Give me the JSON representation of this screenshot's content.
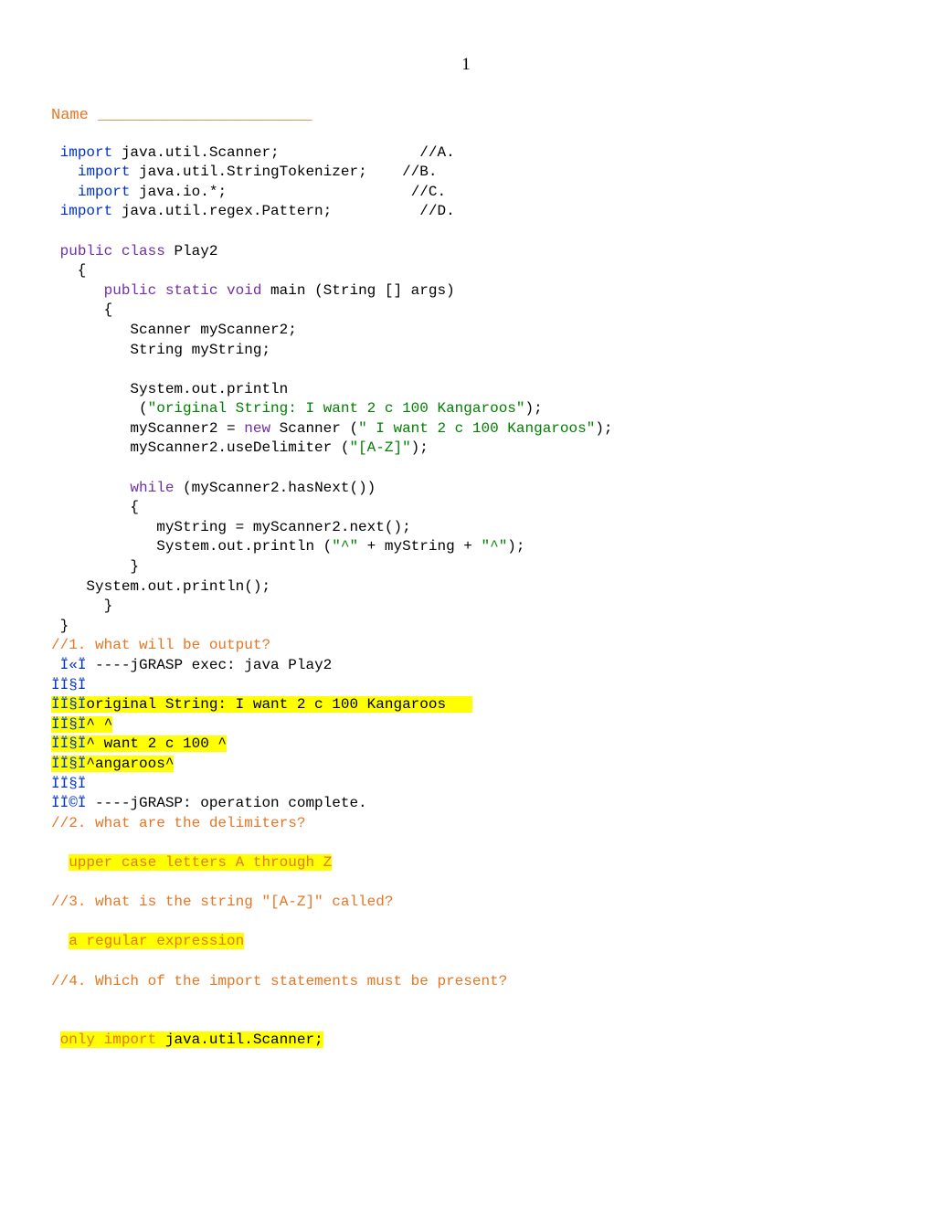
{
  "page_number": "1",
  "name_label": "Name _______________________",
  "code": {
    "kw_import": "import",
    "kw_public": "public",
    "kw_class": "class",
    "kw_static": "static",
    "kw_void": "void",
    "kw_new": "new",
    "kw_while": "while",
    "class_name": "Play2",
    "sig_main": " main (String [] args)",
    "import_a_pkg": " java.util.Scanner;",
    "import_a_cmt": "//A.",
    "import_b_pkg": " java.util.StringTokenizer;",
    "import_b_cmt": "//B.",
    "import_c_pkg": " java.io.*;",
    "import_c_cmt": "//C.",
    "import_d_pkg": " java.util.regex.Pattern;",
    "import_d_cmt": "//D.",
    "decl_scanner": "         Scanner myScanner2;",
    "decl_string": "         String myString;",
    "println_call": "         System.out.println",
    "str_original": "\"original String: I want 2 c 100 Kangaroos\"",
    "paren_open": "          (",
    "paren_close": ");",
    "assign_scanner_pre": "         myScanner2 = ",
    "assign_scanner_post": " Scanner (",
    "str_scanner_arg": "\" I want 2 c 100 Kangaroos\"",
    "close_paren_semi": ");",
    "use_delim_pre": "         myScanner2.useDelimiter (",
    "str_delim": "\"[A-Z]\"",
    "while_cond": " (myScanner2.hasNext())",
    "while_open": "         {",
    "assign_next": "            myString = myScanner2.next();",
    "print_line_pre": "            System.out.println (",
    "caret1": "\"^\"",
    "plus_mystr": " + myString + ",
    "caret2": "\"^\"",
    "while_close": "         }",
    "final_println": "    System.out.println();",
    "method_close": "      }",
    "class_close": " }"
  },
  "q1": {
    "prompt": "//1. what will be output?",
    "line_exec_prefix": "Ï«Ï",
    "line_exec": " ----jGRASP exec: java Play2",
    "blank_prefix": "ÏÏ§Ï",
    "hl_original": "original String: I want 2 c 100 Kangaroos   ",
    "hl_caret1": "^ ^",
    "hl_caret2": "^ want 2 c 100 ^",
    "hl_caret3": "^angaroos^",
    "line_complete_prefix": "ÏÏ©Ï",
    "line_complete": " ----jGRASP: operation complete."
  },
  "q2": {
    "prompt": "//2. what are the delimiters?",
    "answer": "upper case letters A through Z"
  },
  "q3": {
    "prompt": "//3. what is the string \"[A-Z]\" called?",
    "answer": "a regular expression"
  },
  "q4": {
    "prompt": "//4. Which of the import statements must be present?",
    "answer_pre": "only import",
    "answer_post": " java.util.Scanner;"
  }
}
